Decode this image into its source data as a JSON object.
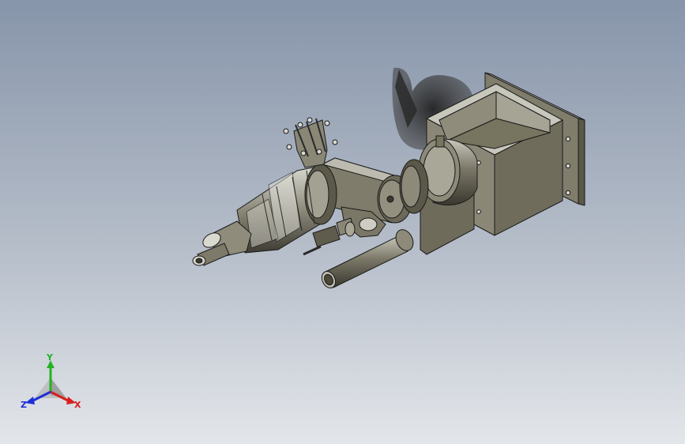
{
  "viewport": {
    "background_top": "#8795aa",
    "background_bottom": "#e3e6ea"
  },
  "model": {
    "body_color": "#6a6756",
    "shadow_color": "#2e2e2e",
    "edge_color": "#1a1a1a"
  },
  "triad": {
    "x_label": "X",
    "y_label": "Y",
    "z_label": "Z",
    "x_color": "#d81e1e",
    "y_color": "#23b323",
    "z_color": "#1e2fd8"
  }
}
